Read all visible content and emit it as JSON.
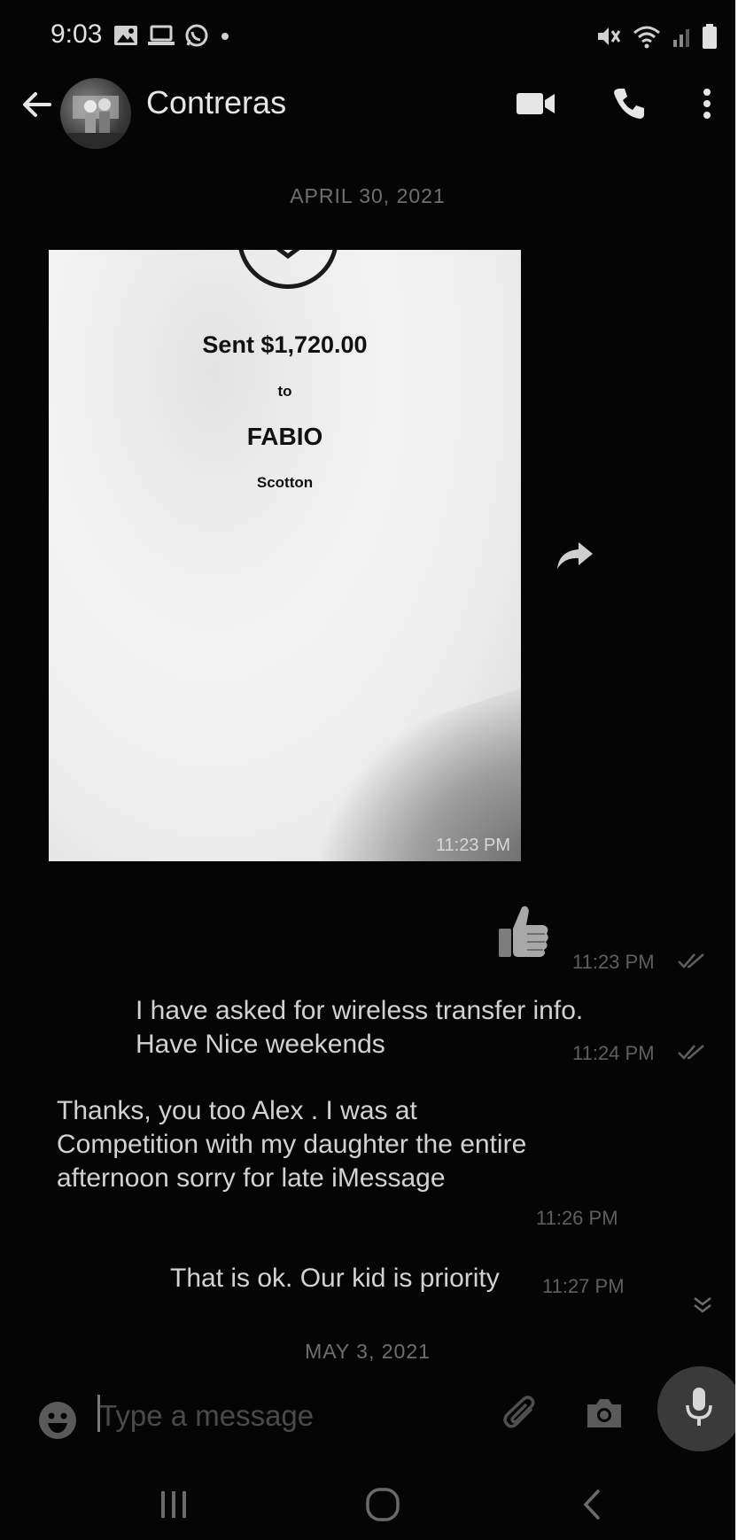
{
  "status_bar": {
    "time": "9:03",
    "left_icons": [
      "gallery-icon",
      "laptop-icon",
      "whatsapp-icon",
      "dot-icon"
    ],
    "right_icons": [
      "mute-icon",
      "wifi-icon",
      "signal-icon",
      "battery-icon"
    ]
  },
  "header": {
    "contact_name": "Contreras",
    "icons": [
      "back-arrow-icon",
      "avatar",
      "video-call-icon",
      "phone-icon",
      "more-vert-icon"
    ]
  },
  "conversation": {
    "date_separators": [
      "APRIL 30, 2021",
      "MAY 3, 2021"
    ],
    "image_message": {
      "sent_amount": "Sent $1,720.00",
      "to": "to",
      "recipient": "FABIO",
      "recipient_sub": "Scotton",
      "time": "11:23 PM"
    },
    "messages": [
      {
        "direction": "outgoing",
        "text": "👍",
        "time": "11:23 PM",
        "status": "read"
      },
      {
        "direction": "outgoing",
        "lines": [
          "I have asked for wireless transfer info.",
          "Have Nice weekends"
        ],
        "time": "11:24 PM",
        "status": "read"
      },
      {
        "direction": "incoming",
        "lines": [
          "Thanks, you too Alex . I was at",
          "Competition with my daughter the entire",
          "afternoon sorry for late iMessage"
        ],
        "time": "11:26 PM"
      },
      {
        "direction": "outgoing",
        "text": "That is ok. Our kid is priority",
        "time": "11:27 PM"
      }
    ]
  },
  "composer": {
    "placeholder": "Type a message",
    "icons": [
      "emoji-icon",
      "attach-icon",
      "camera-icon",
      "mic-icon"
    ]
  },
  "nav_bar": {
    "icons": [
      "recents-icon",
      "home-icon",
      "back-icon"
    ]
  },
  "colors": {
    "background": "#050505",
    "text_primary": "#d2d2d2",
    "text_meta": "#5f5f5f",
    "image_bg": "#efefef"
  }
}
